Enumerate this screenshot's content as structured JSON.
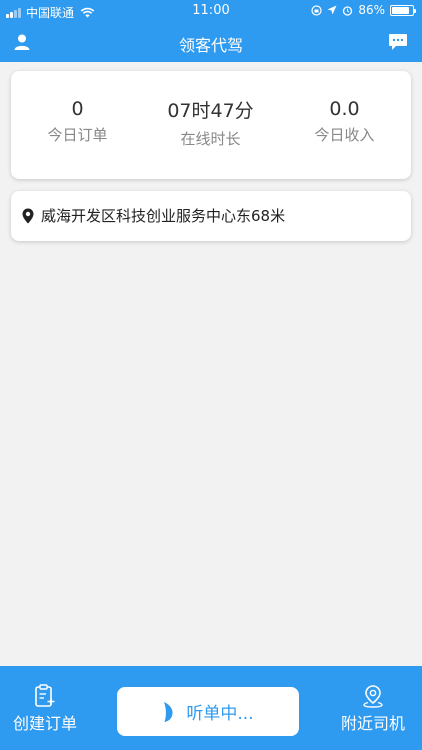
{
  "status_bar": {
    "carrier": "中国联通",
    "time": "11:00",
    "battery": "86%",
    "battery_level": 0.86
  },
  "header": {
    "title": "领客代驾",
    "left_icon": "user-icon",
    "right_icon": "message-icon"
  },
  "stats": {
    "orders_value": "0",
    "orders_label": "今日订单",
    "online_value": "07时47分",
    "online_label": "在线时长",
    "income_value": "0.0",
    "income_label": "今日收入"
  },
  "location": {
    "icon": "location-pin-icon",
    "text": "威海开发区科技创业服务中心东68米"
  },
  "bottom": {
    "create_label": "创建订单",
    "create_icon": "clipboard-add-icon",
    "listen_label": "听单中...",
    "listen_icon": "leaf-icon",
    "nearby_label": "附近司机",
    "nearby_icon": "map-pin-icon"
  },
  "colors": {
    "primary": "#2e9af0",
    "background": "#f2f2f2",
    "card": "#ffffff"
  }
}
